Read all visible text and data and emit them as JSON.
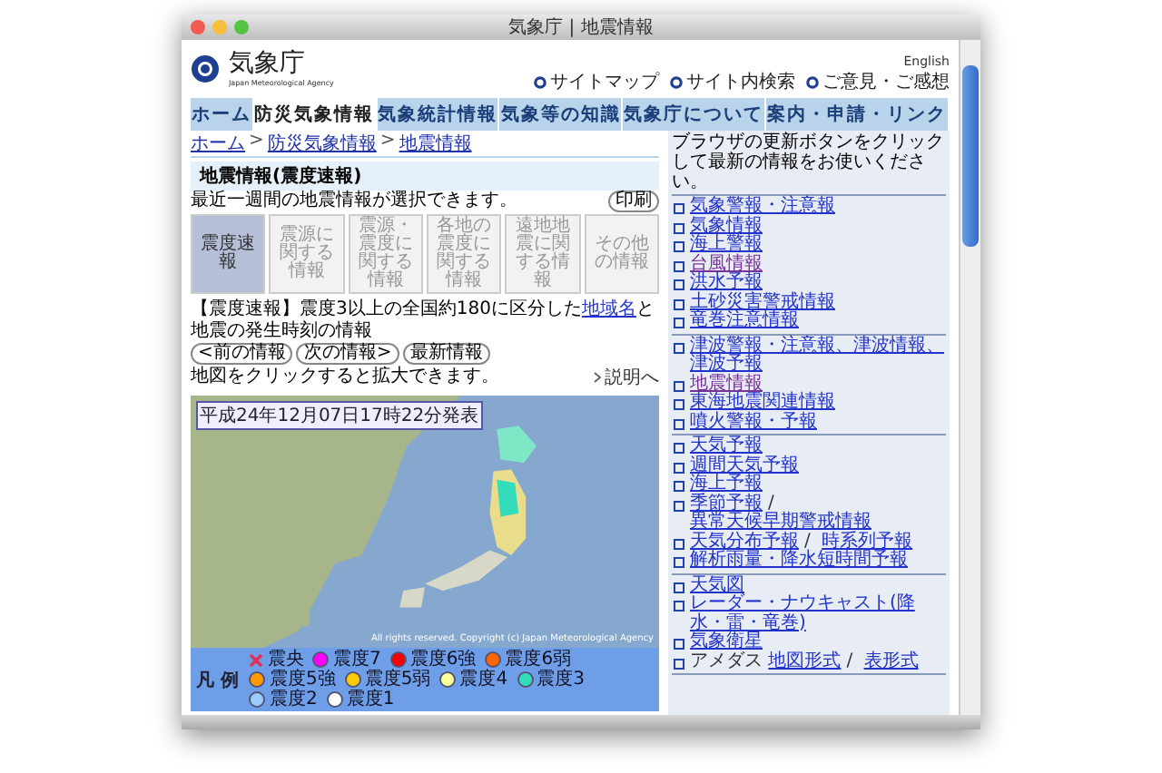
{
  "window": {
    "title": "気象庁 | 地震情報"
  },
  "header": {
    "logo_text": "気象庁",
    "logo_subtitle": "Japan Meteorological Agency",
    "english_link": "English",
    "links": [
      "サイトマップ",
      "サイト内検索",
      "ご意見・ご感想"
    ]
  },
  "nav": [
    {
      "label": "ホーム",
      "selected": false
    },
    {
      "label": "防災気象情報",
      "selected": true
    },
    {
      "label": "気象統計情報",
      "selected": false
    },
    {
      "label": "気象等の知識",
      "selected": false
    },
    {
      "label": "気象庁について",
      "selected": false
    },
    {
      "label": "案内・申請・リンク",
      "selected": false
    }
  ],
  "breadcrumb": [
    "ホーム",
    "防災気象情報",
    "地震情報"
  ],
  "breadcrumb_separator": ">",
  "link_separator": "/",
  "page_title": "地震情報(震度速報)",
  "intro": "最近一週間の地震情報が選択できます。",
  "print_button": "印刷",
  "info_tabs": [
    {
      "label": "震度速報",
      "selected": true
    },
    {
      "label": "震源に関する情報",
      "selected": false
    },
    {
      "label": "震源・震度に関する情報",
      "selected": false
    },
    {
      "label": "各地の震度に関する情報",
      "selected": false
    },
    {
      "label": "遠地地震に関する情報",
      "selected": false
    },
    {
      "label": "その他の情報",
      "selected": false
    }
  ],
  "description": {
    "before": "【震度速報】震度3以上の全国約180に区分した",
    "link": "地域名",
    "after": "と地震の発生時刻の情報"
  },
  "nav_buttons": [
    "<前の情報",
    "次の情報>",
    "最新情報"
  ],
  "map_hint": "地図をクリックすると拡大できます。",
  "explain_link": "説明へ",
  "map": {
    "timestamp": "平成24年12月07日17時22分発表",
    "copyright": "All rights reserved. Copyright (c) Japan Meteorological Agency"
  },
  "legend": {
    "title": "凡 例",
    "items": [
      {
        "kind": "cross",
        "label": "震央",
        "color": "#e0305a"
      },
      {
        "kind": "dot",
        "label": "震度7",
        "color": "#ff00ff"
      },
      {
        "kind": "dot",
        "label": "震度6強",
        "color": "#ff0000"
      },
      {
        "kind": "dot",
        "label": "震度6弱",
        "color": "#ff6600"
      },
      {
        "kind": "dot",
        "label": "震度5強",
        "color": "#ff9900"
      },
      {
        "kind": "dot",
        "label": "震度5弱",
        "color": "#ffcc00"
      },
      {
        "kind": "dot",
        "label": "震度4",
        "color": "#ffff99"
      },
      {
        "kind": "dot",
        "label": "震度3",
        "color": "#33ddbb"
      },
      {
        "kind": "dot",
        "label": "震度2",
        "color": "#99ccff"
      },
      {
        "kind": "dot",
        "label": "震度1",
        "color": "#ffffff"
      }
    ]
  },
  "sidebar": {
    "notice": "ブラウザの更新ボタンをクリックして最新の情報をお使いください。",
    "groups": [
      [
        {
          "links": [
            {
              "label": "気象警報・注意報",
              "visited": false
            }
          ]
        },
        {
          "links": [
            {
              "label": "気象情報",
              "visited": false
            }
          ]
        },
        {
          "links": [
            {
              "label": "海上警報",
              "visited": false
            }
          ]
        },
        {
          "links": [
            {
              "label": "台風情報",
              "visited": true
            }
          ]
        },
        {
          "links": [
            {
              "label": "洪水予報",
              "visited": false
            }
          ]
        },
        {
          "links": [
            {
              "label": "土砂災害警戒情報",
              "visited": false
            }
          ]
        },
        {
          "links": [
            {
              "label": "竜巻注意情報",
              "visited": false
            }
          ]
        }
      ],
      [
        {
          "links": [
            {
              "label": "津波警報・注意報、津波情報、津波予報",
              "visited": false
            }
          ]
        },
        {
          "links": [
            {
              "label": "地震情報",
              "visited": true
            }
          ]
        },
        {
          "links": [
            {
              "label": "東海地震関連情報",
              "visited": false
            }
          ]
        },
        {
          "links": [
            {
              "label": "噴火警報・予報",
              "visited": false
            }
          ]
        }
      ],
      [
        {
          "links": [
            {
              "label": "天気予報",
              "visited": false
            }
          ]
        },
        {
          "links": [
            {
              "label": "週間天気予報",
              "visited": false
            }
          ]
        },
        {
          "links": [
            {
              "label": "海上予報",
              "visited": false
            }
          ]
        },
        {
          "links": [
            {
              "label": "季節予報",
              "visited": false
            },
            {
              "label": "異常天候早期警戒情報",
              "visited": false
            }
          ]
        },
        {
          "links": [
            {
              "label": "天気分布予報",
              "visited": false
            },
            {
              "label": "時系列予報",
              "visited": false
            }
          ]
        },
        {
          "links": [
            {
              "label": "解析雨量・降水短時間予報",
              "visited": false
            }
          ]
        }
      ],
      [
        {
          "links": [
            {
              "label": "天気図",
              "visited": false
            }
          ]
        },
        {
          "links": [
            {
              "label": "レーダー・ナウキャスト(降水・雷・竜巻)",
              "visited": false
            }
          ]
        },
        {
          "links": [
            {
              "label": "気象衛星",
              "visited": false
            }
          ]
        },
        {
          "text": "アメダス",
          "links": [
            {
              "label": "地図形式",
              "visited": false
            },
            {
              "label": "表形式",
              "visited": false
            }
          ]
        }
      ]
    ]
  }
}
